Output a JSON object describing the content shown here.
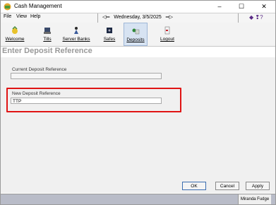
{
  "window": {
    "title": "Cash Management",
    "minimize": "–",
    "maximize": "☐",
    "close": "✕"
  },
  "menu": {
    "items": [
      "File",
      "View",
      "Help"
    ],
    "date_prev": "◁═",
    "date": "Wednesday, 3/5/2025",
    "date_next": "═▷",
    "help_icons": "◆ ❢?"
  },
  "toolbar": {
    "items": [
      {
        "label": "Welcome",
        "icon": "welcome-icon"
      },
      {
        "label": "Tills",
        "icon": "tills-icon"
      },
      {
        "label": "Server Banks",
        "icon": "server-banks-icon"
      },
      {
        "label": "Safes",
        "icon": "safes-icon"
      },
      {
        "label": "Deposits",
        "icon": "deposits-icon"
      },
      {
        "label": "Logout",
        "icon": "logout-icon"
      }
    ],
    "active": "Deposits"
  },
  "page": {
    "title": "Enter Deposit Reference"
  },
  "form": {
    "current_label": "Current Deposit Reference",
    "current_value": "",
    "new_label": "New Deposit Reference",
    "new_value": "TTP"
  },
  "buttons": {
    "ok": "OK",
    "cancel": "Cancel",
    "apply": "Apply"
  },
  "status": {
    "user": "Miranda Fudge"
  },
  "colors": {
    "highlight": "#e01414",
    "active_tab": "#d7e3f2",
    "status_bar": "#b9bcc8"
  }
}
